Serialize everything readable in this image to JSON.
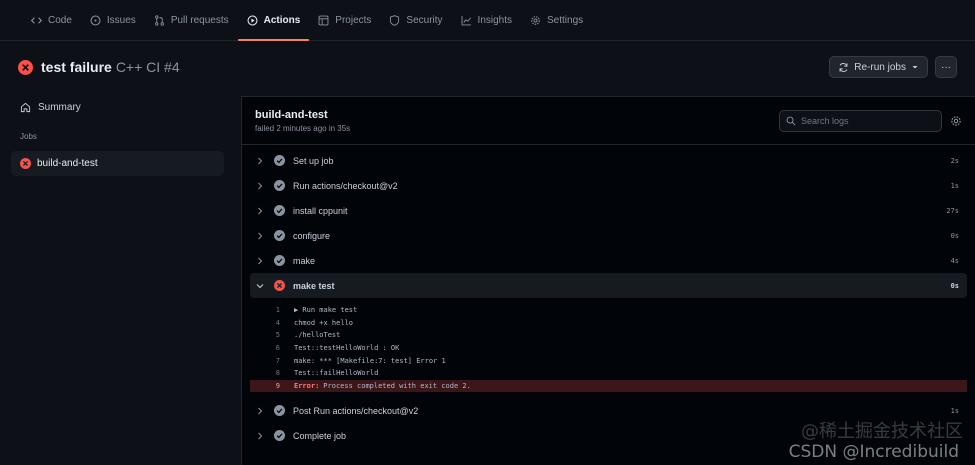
{
  "nav": {
    "tabs": [
      {
        "label": "Code",
        "icon": "code-icon"
      },
      {
        "label": "Issues",
        "icon": "issue-icon"
      },
      {
        "label": "Pull requests",
        "icon": "pull-request-icon"
      },
      {
        "label": "Actions",
        "icon": "play-icon"
      },
      {
        "label": "Projects",
        "icon": "table-icon"
      },
      {
        "label": "Security",
        "icon": "shield-icon"
      },
      {
        "label": "Insights",
        "icon": "graph-icon"
      },
      {
        "label": "Settings",
        "icon": "gear-icon"
      }
    ],
    "active": "Actions"
  },
  "header": {
    "title": "test failure",
    "subtitle": "C++ CI #4",
    "rerun_label": "Re-run jobs",
    "more_label": "···"
  },
  "sidebar": {
    "summary_label": "Summary",
    "jobs_label": "Jobs",
    "job_name": "build-and-test"
  },
  "main": {
    "job_title": "build-and-test",
    "job_status": "failed 2 minutes ago in 35s",
    "search_placeholder": "Search logs"
  },
  "steps": [
    {
      "name": "Set up job",
      "duration": "2s",
      "status": "success"
    },
    {
      "name": "Run actions/checkout@v2",
      "duration": "1s",
      "status": "success"
    },
    {
      "name": "install cppunit",
      "duration": "27s",
      "status": "success"
    },
    {
      "name": "configure",
      "duration": "0s",
      "status": "success"
    },
    {
      "name": "make",
      "duration": "4s",
      "status": "success"
    },
    {
      "name": "make test",
      "duration": "0s",
      "status": "failure"
    },
    {
      "name": "Post Run actions/checkout@v2",
      "duration": "1s",
      "status": "success"
    },
    {
      "name": "Complete job",
      "duration": "",
      "status": "success"
    }
  ],
  "log_lines": [
    {
      "num": "1",
      "text": "▶ Run make test"
    },
    {
      "num": "4",
      "text": "chmod +x hello"
    },
    {
      "num": "5",
      "text": "./helloTest"
    },
    {
      "num": "6",
      "text": "Test::testHelloWorld : OK"
    },
    {
      "num": "7",
      "text": "make: *** [Makefile:7: test] Error 1"
    },
    {
      "num": "8",
      "text": "Test::failHelloWorld"
    },
    {
      "num": "9",
      "error_label": "Error:",
      "text": "Process completed with exit code 2."
    }
  ],
  "watermark": {
    "line1": "@稀土掘金技术社区",
    "line2": "CSDN @Incredibuild"
  },
  "colors": {
    "success": "#8b949e",
    "failure": "#f85149",
    "active_tab_underline": "#f78166"
  }
}
